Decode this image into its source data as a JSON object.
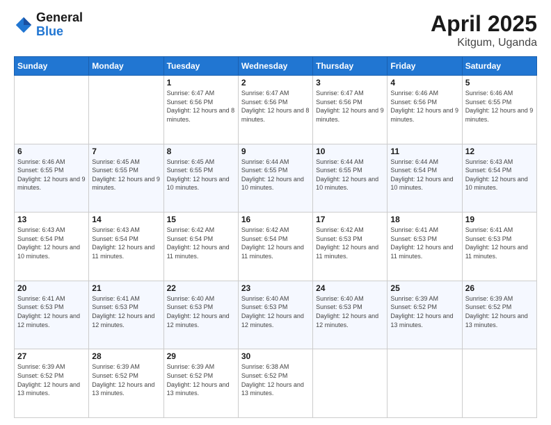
{
  "header": {
    "logo_general": "General",
    "logo_blue": "Blue",
    "title": "April 2025",
    "location": "Kitgum, Uganda"
  },
  "calendar": {
    "days_of_week": [
      "Sunday",
      "Monday",
      "Tuesday",
      "Wednesday",
      "Thursday",
      "Friday",
      "Saturday"
    ],
    "weeks": [
      [
        {
          "day": "",
          "info": ""
        },
        {
          "day": "",
          "info": ""
        },
        {
          "day": "1",
          "info": "Sunrise: 6:47 AM\nSunset: 6:56 PM\nDaylight: 12 hours and 8 minutes."
        },
        {
          "day": "2",
          "info": "Sunrise: 6:47 AM\nSunset: 6:56 PM\nDaylight: 12 hours and 8 minutes."
        },
        {
          "day": "3",
          "info": "Sunrise: 6:47 AM\nSunset: 6:56 PM\nDaylight: 12 hours and 9 minutes."
        },
        {
          "day": "4",
          "info": "Sunrise: 6:46 AM\nSunset: 6:56 PM\nDaylight: 12 hours and 9 minutes."
        },
        {
          "day": "5",
          "info": "Sunrise: 6:46 AM\nSunset: 6:55 PM\nDaylight: 12 hours and 9 minutes."
        }
      ],
      [
        {
          "day": "6",
          "info": "Sunrise: 6:46 AM\nSunset: 6:55 PM\nDaylight: 12 hours and 9 minutes."
        },
        {
          "day": "7",
          "info": "Sunrise: 6:45 AM\nSunset: 6:55 PM\nDaylight: 12 hours and 9 minutes."
        },
        {
          "day": "8",
          "info": "Sunrise: 6:45 AM\nSunset: 6:55 PM\nDaylight: 12 hours and 10 minutes."
        },
        {
          "day": "9",
          "info": "Sunrise: 6:44 AM\nSunset: 6:55 PM\nDaylight: 12 hours and 10 minutes."
        },
        {
          "day": "10",
          "info": "Sunrise: 6:44 AM\nSunset: 6:55 PM\nDaylight: 12 hours and 10 minutes."
        },
        {
          "day": "11",
          "info": "Sunrise: 6:44 AM\nSunset: 6:54 PM\nDaylight: 12 hours and 10 minutes."
        },
        {
          "day": "12",
          "info": "Sunrise: 6:43 AM\nSunset: 6:54 PM\nDaylight: 12 hours and 10 minutes."
        }
      ],
      [
        {
          "day": "13",
          "info": "Sunrise: 6:43 AM\nSunset: 6:54 PM\nDaylight: 12 hours and 10 minutes."
        },
        {
          "day": "14",
          "info": "Sunrise: 6:43 AM\nSunset: 6:54 PM\nDaylight: 12 hours and 11 minutes."
        },
        {
          "day": "15",
          "info": "Sunrise: 6:42 AM\nSunset: 6:54 PM\nDaylight: 12 hours and 11 minutes."
        },
        {
          "day": "16",
          "info": "Sunrise: 6:42 AM\nSunset: 6:54 PM\nDaylight: 12 hours and 11 minutes."
        },
        {
          "day": "17",
          "info": "Sunrise: 6:42 AM\nSunset: 6:53 PM\nDaylight: 12 hours and 11 minutes."
        },
        {
          "day": "18",
          "info": "Sunrise: 6:41 AM\nSunset: 6:53 PM\nDaylight: 12 hours and 11 minutes."
        },
        {
          "day": "19",
          "info": "Sunrise: 6:41 AM\nSunset: 6:53 PM\nDaylight: 12 hours and 11 minutes."
        }
      ],
      [
        {
          "day": "20",
          "info": "Sunrise: 6:41 AM\nSunset: 6:53 PM\nDaylight: 12 hours and 12 minutes."
        },
        {
          "day": "21",
          "info": "Sunrise: 6:41 AM\nSunset: 6:53 PM\nDaylight: 12 hours and 12 minutes."
        },
        {
          "day": "22",
          "info": "Sunrise: 6:40 AM\nSunset: 6:53 PM\nDaylight: 12 hours and 12 minutes."
        },
        {
          "day": "23",
          "info": "Sunrise: 6:40 AM\nSunset: 6:53 PM\nDaylight: 12 hours and 12 minutes."
        },
        {
          "day": "24",
          "info": "Sunrise: 6:40 AM\nSunset: 6:53 PM\nDaylight: 12 hours and 12 minutes."
        },
        {
          "day": "25",
          "info": "Sunrise: 6:39 AM\nSunset: 6:52 PM\nDaylight: 12 hours and 13 minutes."
        },
        {
          "day": "26",
          "info": "Sunrise: 6:39 AM\nSunset: 6:52 PM\nDaylight: 12 hours and 13 minutes."
        }
      ],
      [
        {
          "day": "27",
          "info": "Sunrise: 6:39 AM\nSunset: 6:52 PM\nDaylight: 12 hours and 13 minutes."
        },
        {
          "day": "28",
          "info": "Sunrise: 6:39 AM\nSunset: 6:52 PM\nDaylight: 12 hours and 13 minutes."
        },
        {
          "day": "29",
          "info": "Sunrise: 6:39 AM\nSunset: 6:52 PM\nDaylight: 12 hours and 13 minutes."
        },
        {
          "day": "30",
          "info": "Sunrise: 6:38 AM\nSunset: 6:52 PM\nDaylight: 12 hours and 13 minutes."
        },
        {
          "day": "",
          "info": ""
        },
        {
          "day": "",
          "info": ""
        },
        {
          "day": "",
          "info": ""
        }
      ]
    ]
  }
}
